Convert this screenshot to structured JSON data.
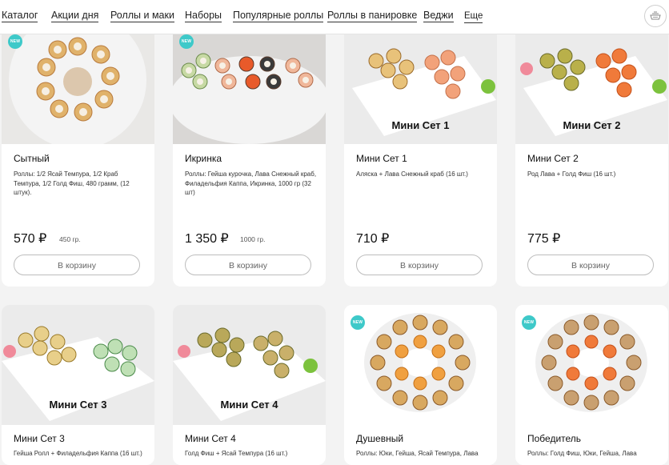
{
  "nav": {
    "items": [
      "Каталог",
      "Акции дня",
      "Роллы и маки",
      "Наборы",
      "Популярные роллы",
      "Роллы в панировке",
      "Веджи",
      "Еще"
    ]
  },
  "colors": {
    "badge": "#3ec9c9",
    "accent_green": "#7cc23d",
    "button_border": "#bdbdbd"
  },
  "cart_icon": "cart-bowl-icon",
  "products": [
    {
      "name": "Сытный",
      "description": "Роллы: 1/2 Ясай Темпура, 1/2 Краб Темпура, 1/2 Голд Фиш, 480 грамм, (12 штук).",
      "price": "570",
      "currency": "₽",
      "weight": "450 гр.",
      "button": "В корзину",
      "badge": "NEW"
    },
    {
      "name": "Икринка",
      "description": "Роллы: Гейша курочка, Лава Снежный краб, Филадельфия Каппа, Икринка, 1000 гр (32 шт)",
      "price": "1 350",
      "currency": "₽",
      "weight": "1000 гр.",
      "button": "В корзину",
      "badge": "NEW"
    },
    {
      "name": "Мини Сет 1",
      "description": "Аляска + Лава Снежный краб (16 шт.)",
      "price": "710",
      "currency": "₽",
      "button": "В корзину",
      "photo_label": "Мини Сет 1"
    },
    {
      "name": "Мини Сет 2",
      "description": "Род Лава + Голд Фиш (16 шт.)",
      "price": "775",
      "currency": "₽",
      "button": "В корзину",
      "photo_label": "Мини Сет 2"
    },
    {
      "name": "Мини Сет 3",
      "description": "Гейша Ролл + Филадельфия Каппа (16 шт.)",
      "photo_label": "Мини Сет 3"
    },
    {
      "name": "Мини Сет 4",
      "description": "Голд Фиш + Ясай Темпура (16 шт.)",
      "photo_label": "Мини Сет 4"
    },
    {
      "name": "Душевный",
      "description": "Роллы: Юки, Гейша, Ясай Темпура, Лава",
      "badge": "NEW"
    },
    {
      "name": "Победитель",
      "description": "Роллы: Голд Фиш, Юки, Гейша, Лава",
      "badge": "NEW"
    }
  ]
}
